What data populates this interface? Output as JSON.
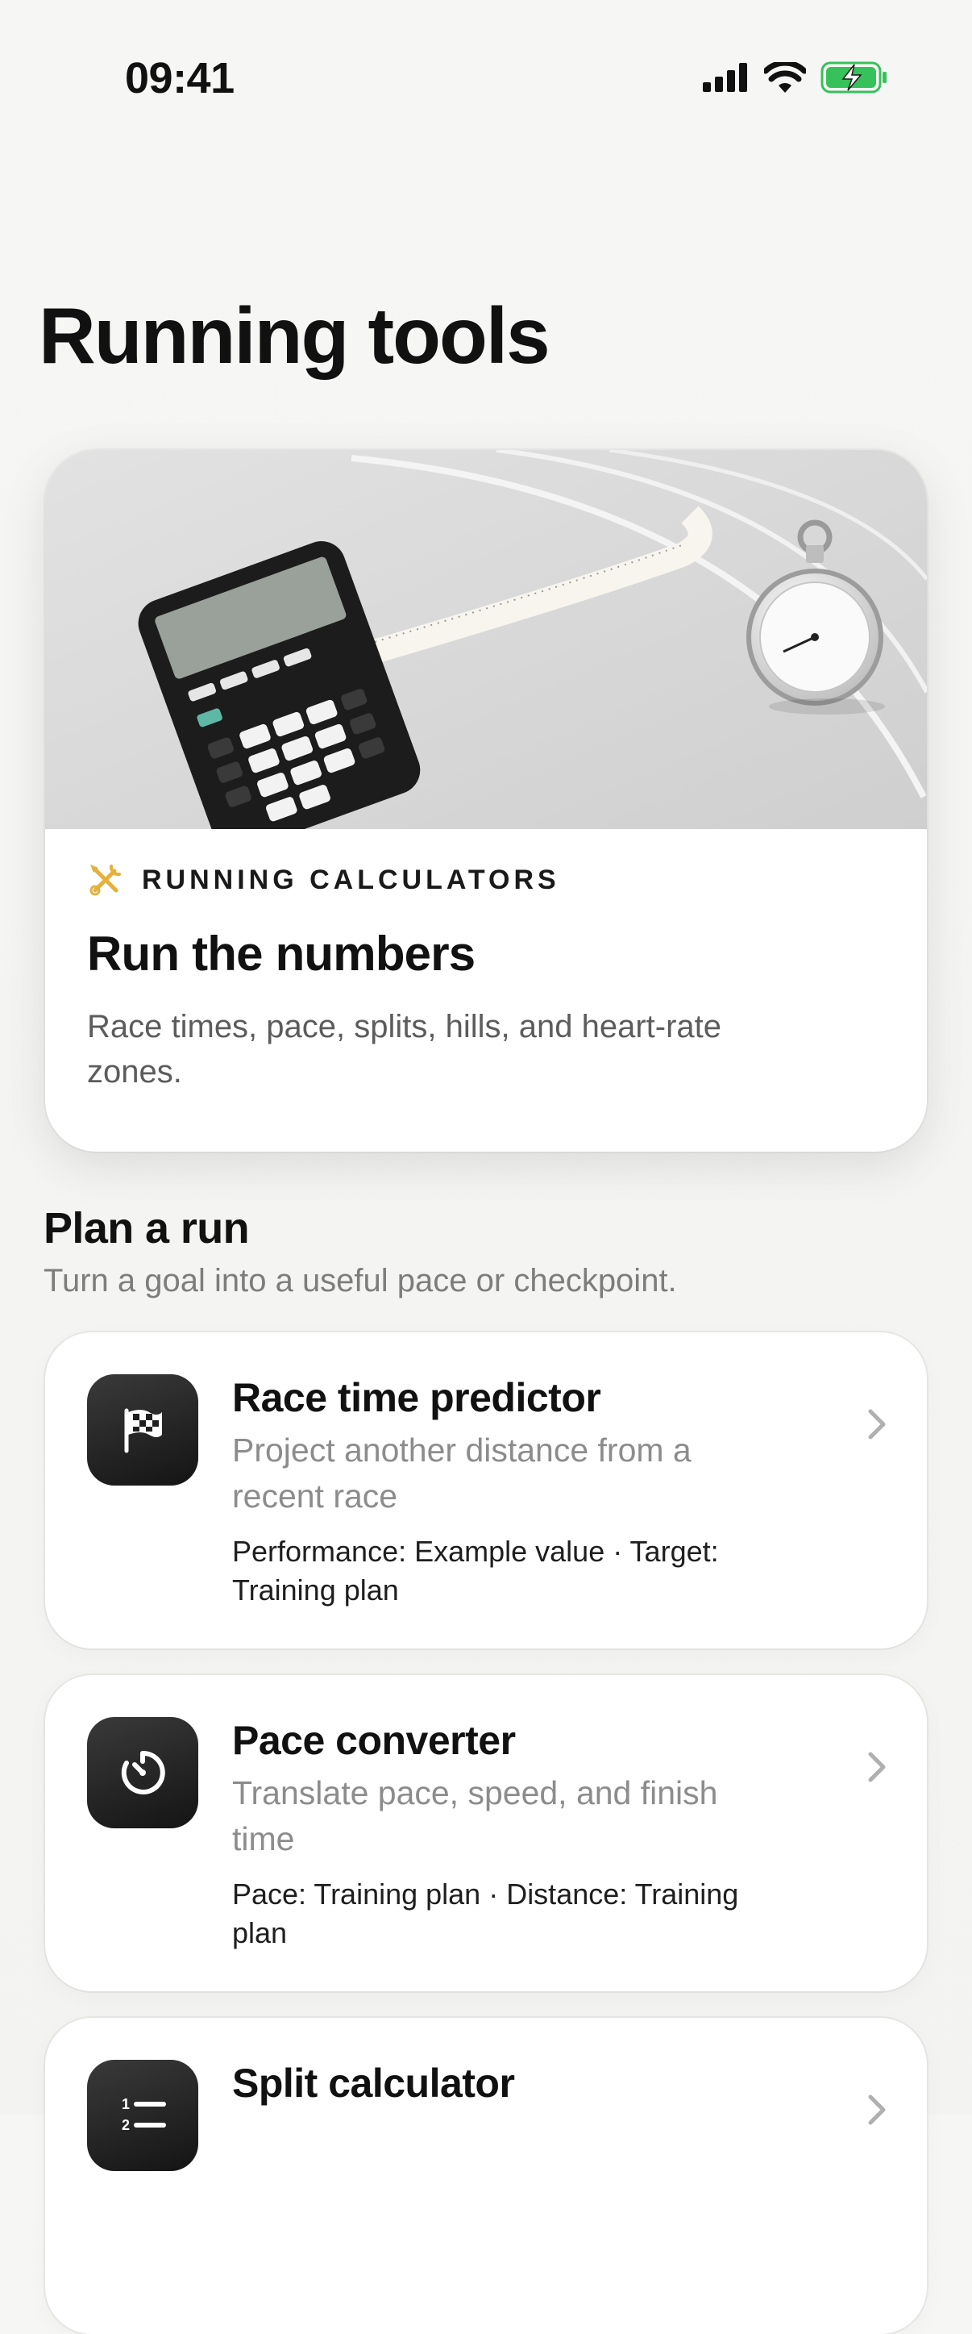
{
  "status_bar": {
    "time": "09:41"
  },
  "page": {
    "title": "Running tools"
  },
  "hero": {
    "eyebrow": "RUNNING CALCULATORS",
    "title": "Run the numbers",
    "description": "Race times, pace, splits, hills, and heart-rate zones.",
    "accent_color": "#e3b23c",
    "icon": "tools-icon",
    "image": "calculator-tape-measure-stopwatch"
  },
  "section": {
    "title": "Plan a run",
    "subtitle": "Turn a goal into a useful pace or checkpoint."
  },
  "tools": [
    {
      "title": "Race time predictor",
      "description": "Project another distance from a recent race",
      "meta": "Performance: Example value · Target: Training plan",
      "icon": "checkered-flag-icon"
    },
    {
      "title": "Pace converter",
      "description": "Translate pace, speed, and finish time",
      "meta": "Pace: Training plan · Distance: Training plan",
      "icon": "timer-icon"
    },
    {
      "title": "Split calculator",
      "description": "",
      "meta": "",
      "icon": "numbered-list-icon"
    }
  ]
}
